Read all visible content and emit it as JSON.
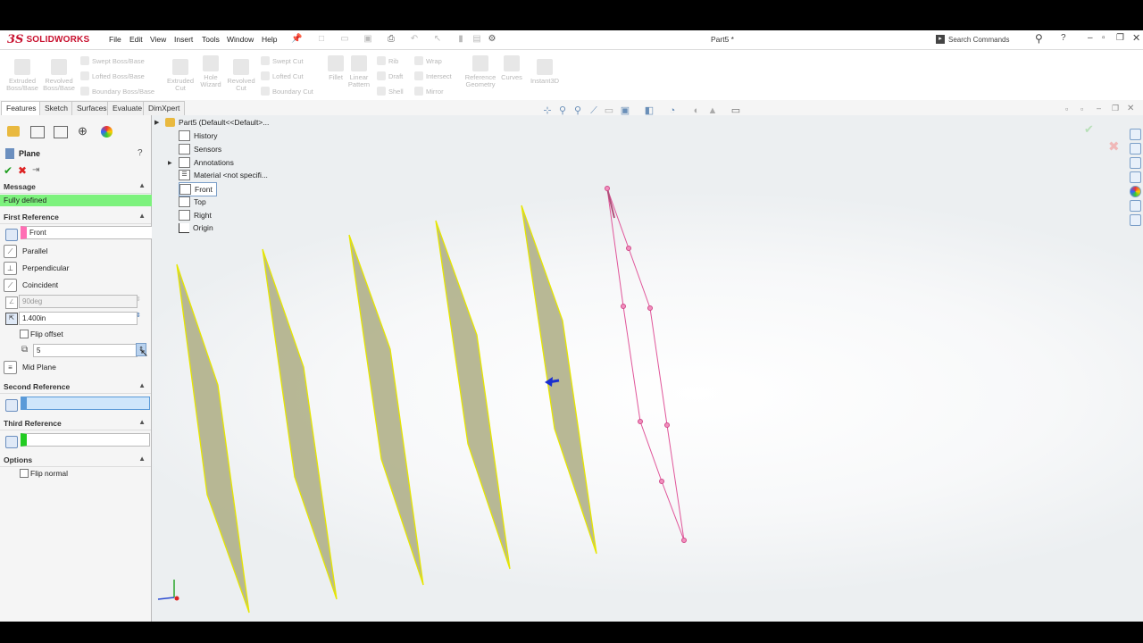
{
  "app": {
    "brand_ds": "3S",
    "brand_name": "SOLIDWORKS",
    "document_title": "Part5 *",
    "search_placeholder": "Search Commands"
  },
  "menu": [
    "File",
    "Edit",
    "View",
    "Insert",
    "Tools",
    "Window",
    "Help"
  ],
  "ribbon": {
    "big": [
      {
        "label1": "Extruded",
        "label2": "Boss/Base"
      },
      {
        "label1": "Revolved",
        "label2": "Boss/Base"
      },
      {
        "label1": "Extruded",
        "label2": "Cut"
      },
      {
        "label1": "Hole",
        "label2": "Wizard"
      },
      {
        "label1": "Revolved",
        "label2": "Cut"
      },
      {
        "label1": "Fillet",
        "label2": ""
      },
      {
        "label1": "Linear",
        "label2": "Pattern"
      },
      {
        "label1": "Reference",
        "label2": "Geometry"
      },
      {
        "label1": "Curves",
        "label2": ""
      },
      {
        "label1": "Instant3D",
        "label2": ""
      }
    ],
    "small": [
      "Swept Boss/Base",
      "Lofted Boss/Base",
      "Boundary Boss/Base",
      "Swept Cut",
      "Lofted Cut",
      "Boundary Cut",
      "Rib",
      "Draft",
      "Shell",
      "Wrap",
      "Intersect",
      "Mirror"
    ]
  },
  "tabs": [
    "Features",
    "Sketch",
    "Surfaces",
    "Evaluate",
    "DimXpert"
  ],
  "pm": {
    "title": "Plane",
    "help": "?",
    "message_header": "Message",
    "message": "Fully defined",
    "first_ref_header": "First Reference",
    "first_ref_value": "Front",
    "parallel": "Parallel",
    "perpendicular": "Perpendicular",
    "coincident": "Coincident",
    "angle": "90deg",
    "offset": "1.400in",
    "flip_offset": "Flip offset",
    "count": "5",
    "mid_plane": "Mid Plane",
    "second_ref_header": "Second Reference",
    "third_ref_header": "Third Reference",
    "options_header": "Options",
    "flip_normal": "Flip normal"
  },
  "tree": {
    "root": "Part5  (Default<<Default>...",
    "items": [
      "History",
      "Sensors",
      "Annotations",
      "Material <not specifi...",
      "Front",
      "Top",
      "Right",
      "Origin"
    ]
  },
  "colors": {
    "plane_fill": "#b0b08a",
    "plane_edge": "#e6e600",
    "sketch": "#e0569a",
    "message_bg": "#7df27d",
    "ref1": "#ff6eb4",
    "ref2": "#9b30ff",
    "ref3": "#22cc22"
  }
}
